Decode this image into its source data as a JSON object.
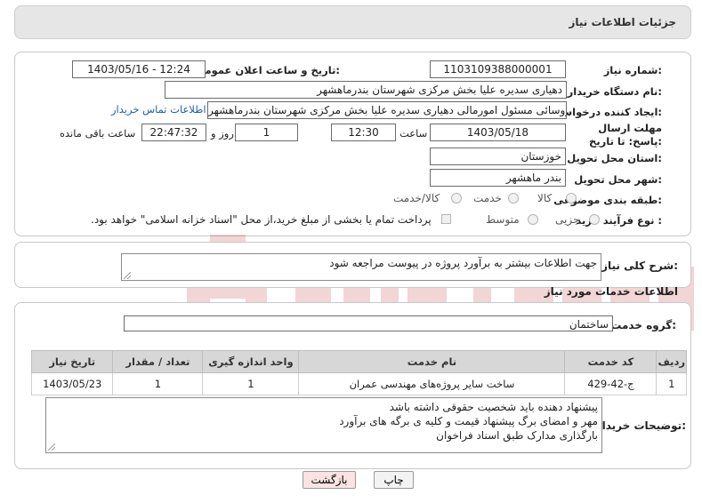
{
  "header": {
    "title": "جزئیات اطلاعات نیاز"
  },
  "form": {
    "need_number_label": "شماره نیاز:",
    "need_number": "1103109388000001",
    "announce_label": "تاریخ و ساعت اعلان عمومی:",
    "announce_value": "1403/05/16 - 12:24",
    "buyer_org_label": "نام دستگاه خریدار:",
    "buyer_org": "دهیاری سدیره علیا بخش مرکزی شهرستان بندرماهشهر",
    "creator_label": "ایجاد کننده درخواست:",
    "creator": "علی اصغر چاروسائی مسئول امورمالی دهیاری سدیره علیا بخش مرکزی شهرستان بندرماهشهر",
    "contact_link": "اطلاعات تماس خریدار",
    "deadline_label": "مهلت ارسال پاسخ: تا تاریخ:",
    "deadline_date": "1403/05/18",
    "time_label": "ساعت",
    "deadline_time": "12:30",
    "days_value": "1",
    "days_label": "روز و",
    "remaining_time": "22:47:32",
    "remaining_label": "ساعت باقی مانده",
    "province_label": "استان محل تحویل:",
    "province": "خوزستان",
    "city_label": "شهر محل تحویل:",
    "city": "بندر ماهشهر",
    "category_label": "طبقه بندی موضوعی:",
    "category_options": [
      "کالا",
      "خدمت",
      "کالا/خدمت"
    ],
    "process_label": "نوع فرآیند خرید :",
    "process_options": [
      "جزیی",
      "متوسط"
    ],
    "payment_note": "پرداخت تمام یا بخشی از مبلغ خرید،از محل \"اسناد خزانه اسلامی\" خواهد بود."
  },
  "summary": {
    "label": "شرح کلی نیاز:",
    "text": "جهت اطلاعات بیشتر به برآورد پروژه در پیوست مراجعه شود"
  },
  "services": {
    "section_title": "اطلاعات خدمات مورد نیاز",
    "group_label": "گروه خدمت:",
    "group_value": "ساختمان",
    "columns": [
      "ردیف",
      "کد خدمت",
      "نام خدمت",
      "واحد اندازه گیری",
      "تعداد / مقدار",
      "تاریخ نیاز"
    ],
    "rows": [
      [
        "1",
        "ج-42-429",
        "ساخت سایر پروژه‌های مهندسی عمران",
        "1",
        "1",
        "1403/05/23"
      ]
    ]
  },
  "buyer_notes": {
    "label": "توضیحات خریدار:",
    "text": "پیشنهاد دهنده باید شخصیت حقوقی داشته باشد\nمهر و امضای برگ پیشنهاد قیمت و کلیه ی برگه های برآورد\nبارگذاری مدارک طبق اسناد فراخوان"
  },
  "buttons": {
    "print": "چاپ",
    "back": "بازگشت"
  },
  "colors": {
    "link": "#1a5fb4",
    "back_button": "#fbe3e3",
    "header": "#e6e6e6"
  }
}
